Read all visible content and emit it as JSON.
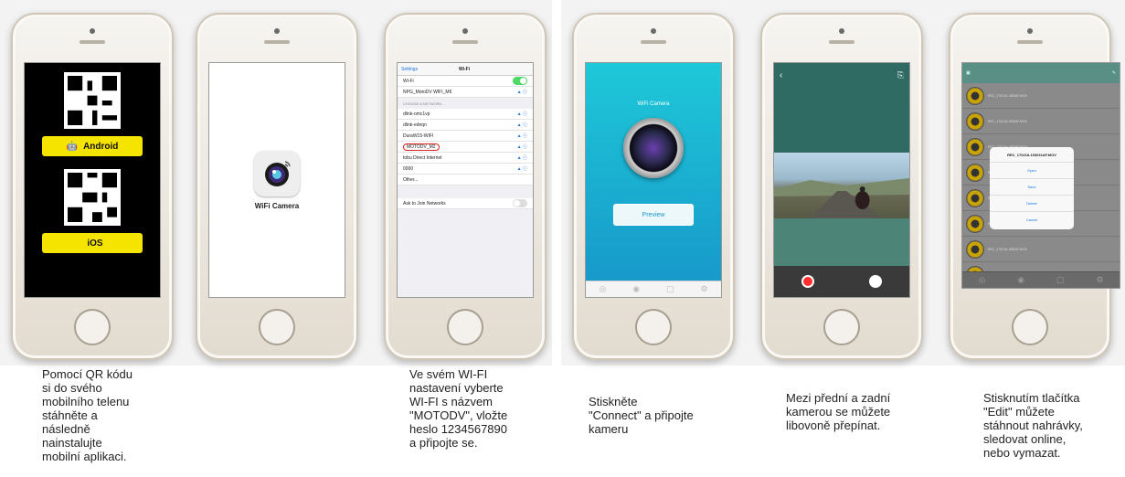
{
  "screen1": {
    "android_label": "Android",
    "ios_label": "iOS"
  },
  "screen2": {
    "app_label": "WiFi Camera"
  },
  "screen3": {
    "back_label": "Settings",
    "title": "Wi-Fi",
    "wifi_label": "Wi-Fi",
    "connected": "NPG_MotoDV WIFI_M6",
    "section": "CHOOSE A NETWORK...",
    "networks": [
      "dlink-omc1vp",
      "dlink-ednqn",
      "DuraW15-WIFI",
      "MOTODV_M2",
      "tobu Direct Internet",
      "0000",
      "Other..."
    ],
    "ask_label": "Ask to Join Networks"
  },
  "screen4": {
    "title": "WiFi Camera",
    "connect": "Preview"
  },
  "screen6": {
    "dialog_title": "REC_170218-153031AF.MOV",
    "options": [
      "Open",
      "Save",
      "Delete",
      "Cancel"
    ],
    "files": [
      "REC_170218-1553AF.MOV",
      "REC_170218-1553AF.MOV",
      "REC_170218-1553AF.MOV",
      "REC_170218-1553AF.MOV",
      "REC_170218-1552AF.MOV",
      "REC_170218-1552AF.MOV",
      "REC_170218-1552AF.MOV",
      "REC_170218-1552AF.MOV"
    ]
  },
  "captions": {
    "c1": "Pomocí QR kódu\nsi do svého\nmobilního telenu\nstáhněte a\nnásledně\nnainstalujte\nmobilní aplikaci.",
    "c3": "Ve svém WI-FI\nnastavení vyberte\nWI-FI s názvem\n\"MOTODV\", vložte\nheslo 1234567890\na připojte se.",
    "c4": "Stiskněte\n\"Connect\" a připojte\nkameru",
    "c5": "Mezi přední a zadní\nkamerou se můžete\nlibovoně přepínat.",
    "c6": "Stisknutím tlačítka\n\"Edit\" můžete\nstáhnout nahrávky,\nsledovat online,\nnebo vymazat."
  }
}
